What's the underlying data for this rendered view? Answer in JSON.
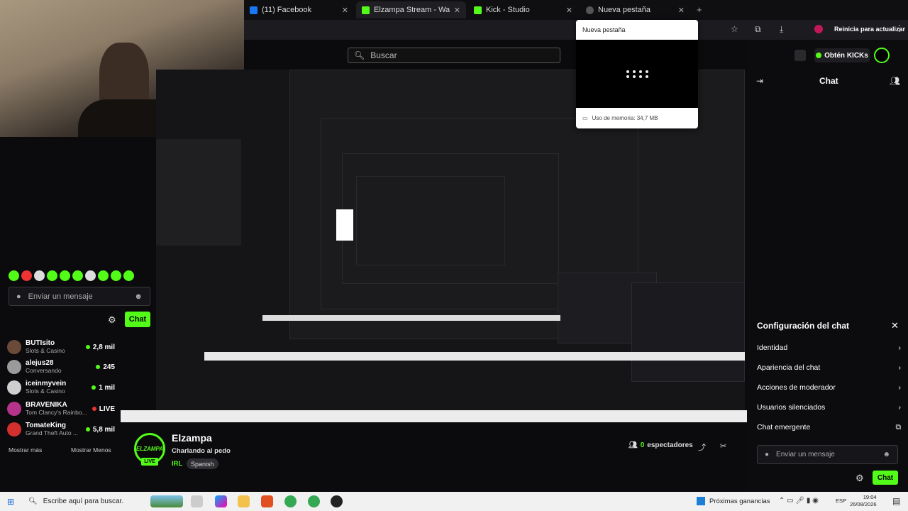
{
  "browser": {
    "tabs": [
      {
        "label": "(11) Facebook",
        "color": "#1877f2"
      },
      {
        "label": "Elzampa Stream - Watch Li",
        "color": "#53fc18"
      },
      {
        "label": "Kick - Studio",
        "color": "#53fc18"
      },
      {
        "label": "Nueva pestaña",
        "color": "#888888"
      }
    ],
    "update_button": "Reinicia para actualizar",
    "tab_preview": {
      "title": "Nueva pestaña",
      "memory": "Uso de memoria: 34,7 MB"
    }
  },
  "search": {
    "placeholder": "Buscar"
  },
  "kick": {
    "get_kicks": "Obtén KICKs",
    "chat_header": "Chat",
    "chat_settings": {
      "title": "Configuración del chat",
      "items": [
        "Identidad",
        "Apariencia del chat",
        "Acciones de moderador",
        "Usuarios silenciados",
        "Chat emergente"
      ]
    },
    "message_placeholder": "Enviar un mensaje",
    "chat_button": "Chat"
  },
  "recommended": [
    {
      "name": "BUTIsito",
      "category": "Slots & Casino",
      "viewers": "2,8 mil",
      "live": false
    },
    {
      "name": "alejus28",
      "category": "Conversando",
      "viewers": "245",
      "live": false
    },
    {
      "name": "iceinmyvein",
      "category": "Slots & Casino",
      "viewers": "1 mil",
      "live": false
    },
    {
      "name": "BRAVENIKA",
      "category": "Tom Clancy's Rainbo...",
      "viewers": "LIVE",
      "live": true
    },
    {
      "name": "TomateKing",
      "category": "Grand Theft Auto ...",
      "viewers": "5,8 mil",
      "live": false
    }
  ],
  "show_more": "Mostrar más",
  "show_less": "Mostrar Menos",
  "channel": {
    "avatar_text": "ELZAMPA",
    "live_badge": "LIVE",
    "name": "Elzampa",
    "title": "Charlando al pedo",
    "category": "IRL",
    "tag": "Spanish",
    "viewers_count": "0",
    "viewers_label": "espectadores"
  },
  "taskbar": {
    "search_placeholder": "Escribe aquí para buscar.",
    "widget": "Próximas ganancias",
    "lang": "ESP",
    "time": "19:04",
    "date": "26/08/2026"
  }
}
